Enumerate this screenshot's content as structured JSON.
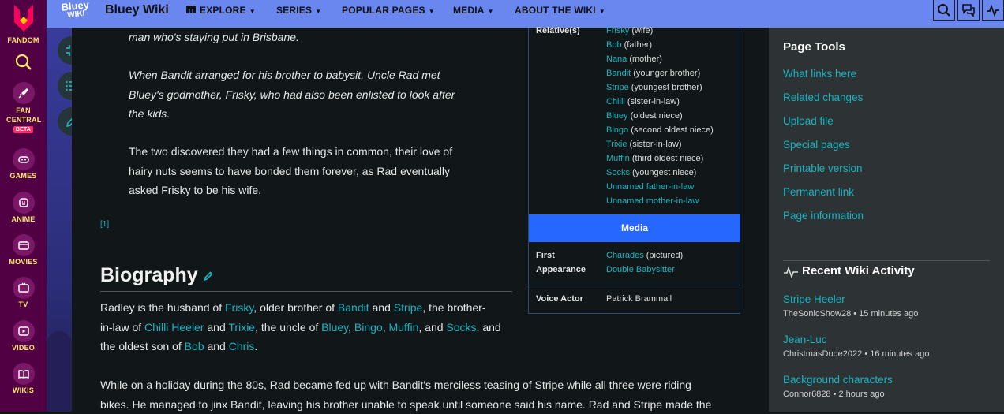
{
  "fandom_rail": {
    "logo_label": "FANDOM",
    "items": [
      {
        "label": "FAN CENTRAL",
        "badge": "BETA",
        "icon": "rocket-icon"
      },
      {
        "label": "GAMES",
        "icon": "gamepad-icon"
      },
      {
        "label": "ANIME",
        "icon": "anime-face-icon"
      },
      {
        "label": "MOVIES",
        "icon": "clapperboard-icon"
      },
      {
        "label": "TV",
        "icon": "tv-icon"
      },
      {
        "label": "VIDEO",
        "icon": "play-icon"
      },
      {
        "label": "WIKIS",
        "icon": "book-icon"
      }
    ]
  },
  "header": {
    "logo_text_top": "Bluey",
    "logo_text_bottom": "WIKI",
    "wiki_name": "Bluey Wiki",
    "nav": [
      "EXPLORE",
      "SERIES",
      "POPULAR PAGES",
      "MEDIA",
      "ABOUT THE WIKI"
    ]
  },
  "article": {
    "quote_p1_tail": "man who's staying put in Brisbane.",
    "quote_p2": [
      "When Bandit arranged for his brother to babysit, Uncle Rad met",
      "Bluey's godmother, Frisky, who had also been enlisted to look after",
      "the kids."
    ],
    "p3": [
      "The two discovered they had a few things in common, their love of",
      "hairy nuts seems to have bonded them forever, as Rad eventually",
      "asked Frisky to be his wife."
    ],
    "ref": "[1]",
    "bio_heading": "Biography",
    "bio_p1": {
      "t1": "Radley is the husband of ",
      "l1": "Frisky",
      "t2": ", older brother of ",
      "l2": "Bandit",
      "t3": " and ",
      "l3": "Stripe",
      "t4": ", the brother-",
      "t5": "in-law of ",
      "l4": "Chilli Heeler",
      "t6": " and ",
      "l5": "Trixie",
      "t7": ", the uncle of ",
      "l6": "Bluey",
      "t8": ", ",
      "l7": "Bingo",
      "t9": ", ",
      "l8": "Muffin",
      "t10": ", and ",
      "l9": "Socks",
      "t11": ", and",
      "t12": "the oldest son of ",
      "l10": "Bob",
      "t13": " and ",
      "l11": "Chris",
      "t14": "."
    },
    "bio_p2": [
      "While on a holiday during the 80s, Rad became fed up with Bandit's merciless teasing of Stripe while all three were riding",
      "bikes. He managed to jinx Bandit, leaving his brother unable to speak until someone said his name. Rad and Stripe made the"
    ]
  },
  "infobox": {
    "relatives_label": "Relative(s)",
    "relatives": [
      {
        "name": "Frisky",
        "rel": " (wife)"
      },
      {
        "name": "Bob",
        "rel": " (father)"
      },
      {
        "name": "Nana",
        "rel": " (mother)"
      },
      {
        "name": "Bandit",
        "rel": " (younger brother)"
      },
      {
        "name": "Stripe",
        "rel": " (youngest brother)"
      },
      {
        "name": "Chilli",
        "rel": " (sister-in-law)"
      },
      {
        "name": "Bluey",
        "rel": " (oldest niece)"
      },
      {
        "name": "Bingo",
        "rel": " (second oldest niece)"
      },
      {
        "name": "Trixie",
        "rel": " (sister-in-law)"
      },
      {
        "name": "Muffin",
        "rel": " (third oldest niece)"
      },
      {
        "name": "Socks",
        "rel": " (youngest niece)"
      },
      {
        "name": "Unnamed father-in-law",
        "rel": ""
      },
      {
        "name": "Unnamed mother-in-law",
        "rel": ""
      }
    ],
    "media_header": "Media",
    "first_appearance_label_1": "First",
    "first_appearance_label_2": "Appearance",
    "first_appearance_link": "Charades",
    "first_appearance_note": " (pictured)",
    "first_appearance_link2": "Double Babysitter",
    "voice_actor_label": "Voice Actor",
    "voice_actor": "Patrick Brammall"
  },
  "right_rail": {
    "page_tools_title": "Page Tools",
    "page_tools": [
      "What links here",
      "Related changes",
      "Upload file",
      "Special pages",
      "Printable version",
      "Permanent link",
      "Page information"
    ],
    "activity_title": "Recent Wiki Activity",
    "activity": [
      {
        "title": "Stripe Heeler",
        "meta": "TheSonicShow28 • 15 minutes ago"
      },
      {
        "title": "Jean-Luc",
        "meta": "ChristmasDude2022 • 16 minutes ago"
      },
      {
        "title": "Background characters",
        "meta": "Connor6828 • 2 hours ago"
      }
    ]
  },
  "colors": {
    "link": "#18b3c1",
    "header": "#6a86ef",
    "fandom_rail": "#520044",
    "media_header": "#2667ff"
  }
}
